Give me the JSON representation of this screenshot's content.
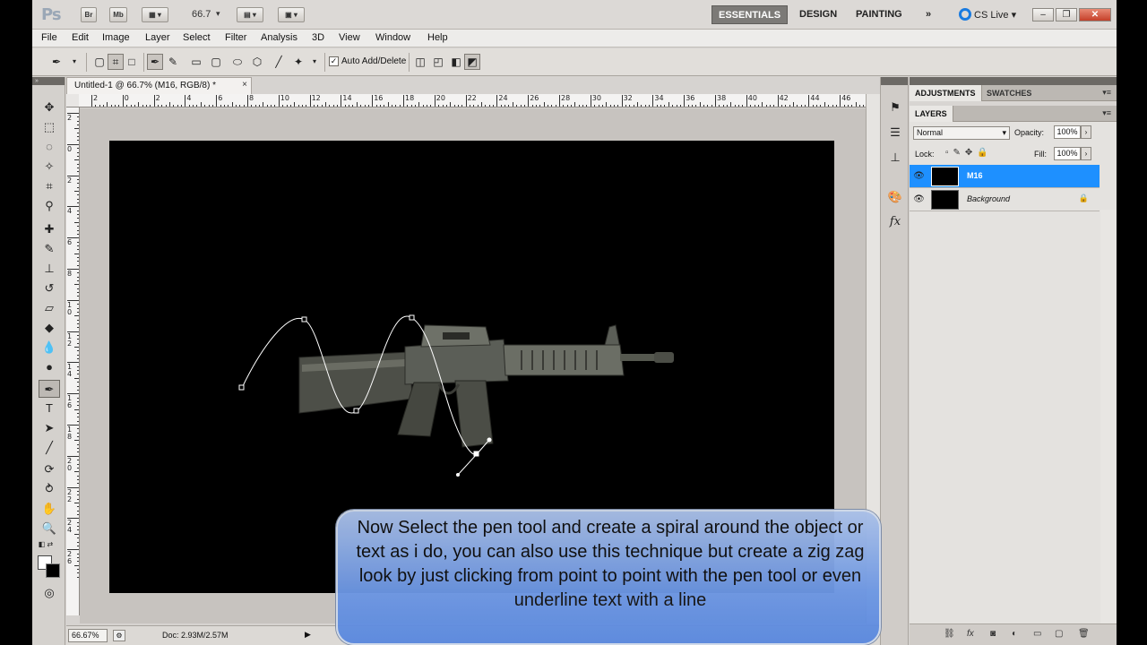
{
  "app": {
    "logo": "Ps",
    "bridge": "Br",
    "mini_bridge": "Mb",
    "zoom_level": "66.7",
    "workspaces": [
      "ESSENTIALS",
      "DESIGN",
      "PAINTING"
    ],
    "workspace_more": "»",
    "cs_live": "CS Live",
    "window_minimize": "–",
    "window_restore": "❐",
    "window_close": "✕"
  },
  "menu": [
    "File",
    "Edit",
    "Image",
    "Layer",
    "Select",
    "Filter",
    "Analysis",
    "3D",
    "View",
    "Window",
    "Help"
  ],
  "options_bar": {
    "auto_add_delete_checked": true,
    "auto_add_delete_label": "Auto Add/Delete"
  },
  "document": {
    "tab_title": "Untitled-1 @ 66.7% (M16, RGB/8) *",
    "tab_close": "×",
    "ruler_h_labels": [
      "2",
      "0",
      "2",
      "4",
      "6",
      "8",
      "10",
      "12",
      "14",
      "16",
      "18",
      "20",
      "22",
      "24",
      "26",
      "28",
      "30",
      "32",
      "34",
      "36",
      "38",
      "40",
      "42",
      "44",
      "46"
    ],
    "ruler_v_labels": [
      "2",
      "0",
      "2",
      "4",
      "6",
      "8",
      "1 0",
      "1 2",
      "1 4",
      "1 6",
      "1 8",
      "2 0",
      "2 2",
      "2 4",
      "2 6"
    ]
  },
  "status_bar": {
    "zoom": "66.67%",
    "doc_info": "Doc: 2.93M/2.57M"
  },
  "panels": {
    "tabs_top": [
      "ADJUSTMENTS",
      "SWATCHES"
    ],
    "tab_layers": "LAYERS",
    "blend_mode": "Normal",
    "opacity_label": "Opacity:",
    "opacity_value": "100%",
    "lock_label": "Lock:",
    "fill_label": "Fill:",
    "fill_value": "100%",
    "layers": [
      {
        "name": "M16",
        "selected": true,
        "locked": false
      },
      {
        "name": "Background",
        "selected": false,
        "locked": true
      }
    ]
  },
  "caption": "Now Select the pen tool and create a spiral around the object or text as i do, you can also use this technique but create a zig zag look by just clicking from point to point with the pen tool or even underline text with a line"
}
